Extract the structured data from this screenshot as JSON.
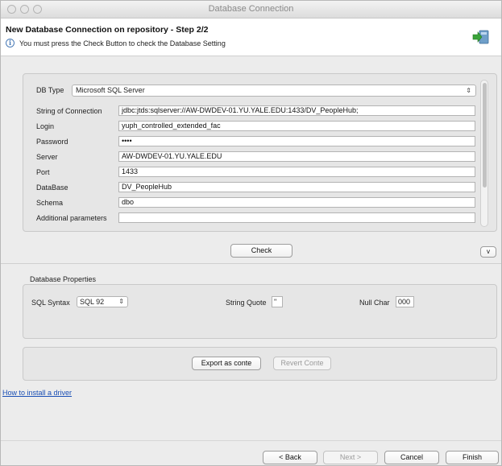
{
  "window": {
    "title": "Database Connection"
  },
  "header": {
    "title": "New Database Connection on repository - Step 2/2",
    "message": "You must press the Check Button to check the Database Setting"
  },
  "connection": {
    "db_type_label": "DB Type",
    "db_type_value": "Microsoft SQL Server",
    "fields": [
      {
        "label": "String of Connection",
        "value": "jdbc:jtds:sqlserver://AW-DWDEV-01.YU.YALE.EDU:1433/DV_PeopleHub;"
      },
      {
        "label": "Login",
        "value": "yuph_controlled_extended_fac"
      },
      {
        "label": "Password",
        "value": "••••"
      },
      {
        "label": "Server",
        "value": "AW-DWDEV-01.YU.YALE.EDU"
      },
      {
        "label": "Port",
        "value": "1433"
      },
      {
        "label": "DataBase",
        "value": "DV_PeopleHub"
      },
      {
        "label": "Schema",
        "value": "dbo"
      },
      {
        "label": "Additional parameters",
        "value": ""
      }
    ]
  },
  "buttons": {
    "check": "Check",
    "toggle": "v",
    "export": "Export as conte",
    "revert": "Revert Conte",
    "back": "< Back",
    "next": "Next >",
    "cancel": "Cancel",
    "finish": "Finish"
  },
  "properties": {
    "section_label": "Database Properties",
    "sql_syntax_label": "SQL Syntax",
    "sql_syntax_value": "SQL 92",
    "string_quote_label": "String Quote",
    "string_quote_value": "\"",
    "null_char_label": "Null Char",
    "null_char_value": "000"
  },
  "link": {
    "install_driver": "How to install a driver"
  },
  "icons": {
    "info": "info-icon",
    "wizard": "database-wizard-icon",
    "select_arrows": "updown-arrows-icon"
  },
  "colors": {
    "link": "#1a4fb5",
    "accent_green": "#3aa33a"
  }
}
